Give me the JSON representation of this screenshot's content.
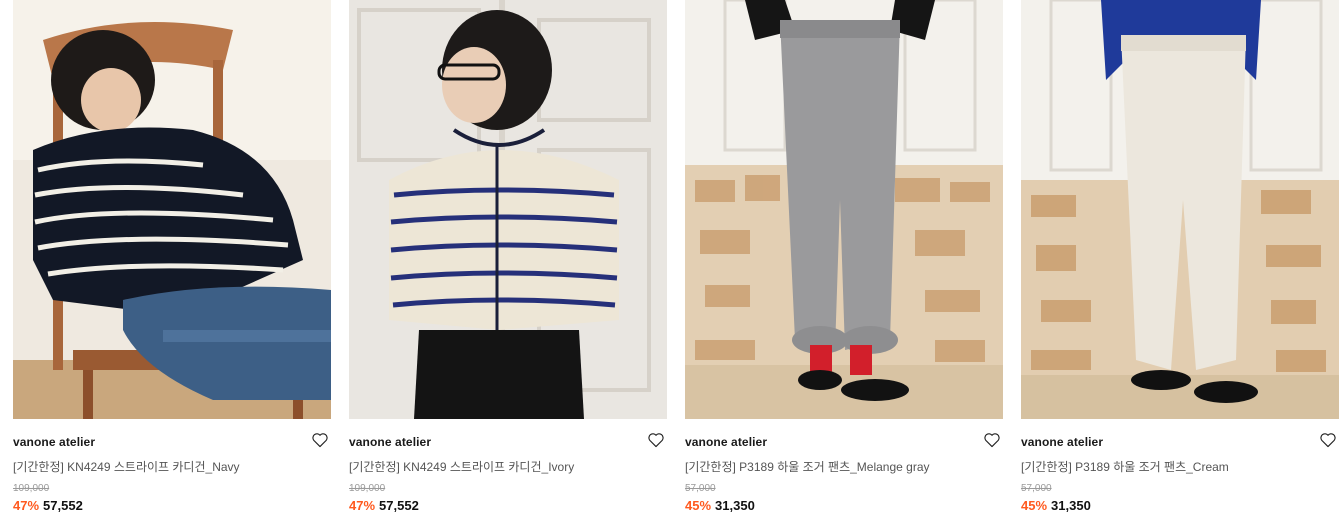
{
  "products": [
    {
      "brand": "vanone atelier",
      "title": "[기간한정] KN4249 스트라이프 카디건_Navy",
      "original_price": "109,000",
      "discount": "47%",
      "price": "57,552",
      "wishlist_icon": "heart-outline-icon"
    },
    {
      "brand": "vanone atelier",
      "title": "[기간한정] KN4249 스트라이프 카디건_Ivory",
      "original_price": "109,000",
      "discount": "47%",
      "price": "57,552",
      "wishlist_icon": "heart-outline-icon"
    },
    {
      "brand": "vanone atelier",
      "title": "[기간한정] P3189 하울 조거 팬츠_Melange gray",
      "original_price": "57,000",
      "discount": "45%",
      "price": "31,350",
      "wishlist_icon": "heart-outline-icon"
    },
    {
      "brand": "vanone atelier",
      "title": "[기간한정] P3189 하울 조거 팬츠_Cream",
      "original_price": "57,000",
      "discount": "45%",
      "price": "31,350",
      "wishlist_icon": "heart-outline-icon"
    }
  ],
  "colors": {
    "discount": "#ff5a1f",
    "original_price": "#9a9a9a",
    "title": "#555555"
  }
}
